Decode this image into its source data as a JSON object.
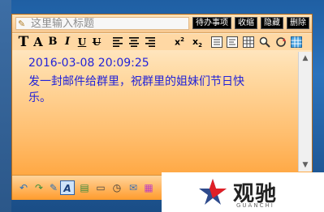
{
  "note": {
    "title_placeholder": "这里输入标题",
    "buttons": {
      "todo": "待办事项",
      "collapse": "收缩",
      "hide": "隐藏",
      "delete": "删除"
    },
    "toolbar": {
      "bold_A": "A",
      "bold_B": "B",
      "italic": "I",
      "underline": "U",
      "strike": "U"
    },
    "content": {
      "datetime": "2016-03-08 20:09:25",
      "line1": "发一封邮件给群里，祝群里的姐妹们节日快",
      "line2": "乐。"
    }
  },
  "watermark": {
    "brand": "观驰",
    "sub": "GUANCHI"
  }
}
